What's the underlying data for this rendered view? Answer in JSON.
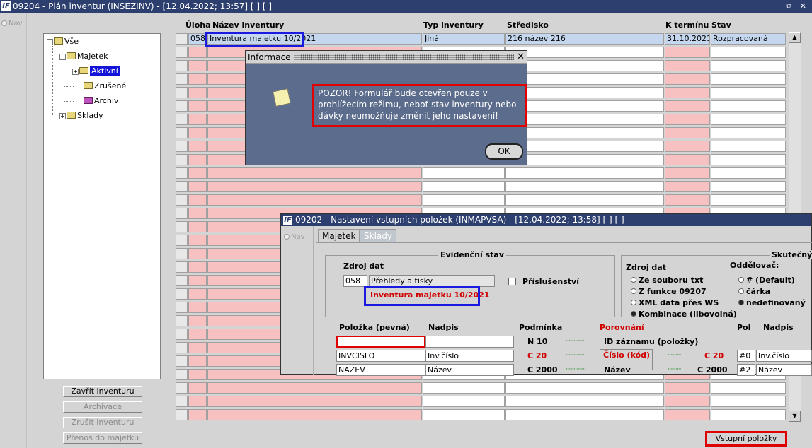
{
  "main_window": {
    "title": "09204 - Plán inventur (INSEZINV) - [12.04.2022; 13:57]  [ ]  [ ]",
    "controls": "⧉ ✕"
  },
  "nav_label": "Nav",
  "tree": {
    "root": "Vše",
    "majetek": "Majetek",
    "aktivni": "Aktivní",
    "zrusene": "Zrušené",
    "archiv": "Archiv",
    "sklady": "Sklady"
  },
  "side_buttons": {
    "zavrit": "Zavřít inventuru",
    "archivace": "Archivace",
    "zrusit": "Zrušit inventuru",
    "prenos": "Přenos do majetku"
  },
  "grid": {
    "headers": {
      "uloha": "Úloha",
      "nazev": "Název inventury",
      "typ": "Typ inventury",
      "stredisko": "Středisko",
      "termin": "K termínu",
      "stav": "Stav"
    },
    "first_row": {
      "uloha": "058",
      "nazev": "Inventura majetku 10/2021",
      "typ": "Jiná",
      "stredisko": "216 název 216",
      "termin": "31.10.2021",
      "stav": "Rozpracovaná"
    }
  },
  "vstup_button": "Vstupní položky",
  "info_dialog": {
    "title": "Informace",
    "message": "POZOR! Formulář bude otevřen pouze v prohlížecím režimu, neboť stav inventury nebo dávky neumožňuje změnit jeho nastavení!",
    "ok": "OK"
  },
  "win2": {
    "title": "09202 - Nastavení vstupních položek (INMAPVSA) - [12.04.2022; 13:58]  [ ]  [ ]",
    "nav": "Nav",
    "tabs": [
      "Majetek",
      "Sklady"
    ],
    "evidencni_stav": "Evidenční stav",
    "skutecny": "Skutečný",
    "zdroj_dat_left": "Zdroj dat",
    "zdroj_code": "058",
    "zdroj_name": "Přehledy a tisky",
    "inventura_name": "Inventura majetku 10/2021",
    "prislusenstvi": "Příslušenství",
    "zdroj_dat_right": "Zdroj dat",
    "oddelovac": "Oddělovač:",
    "radios_source": [
      "Ze souboru txt",
      "Z funkce 09207",
      "XML data přes WS",
      "Kombinace (libovolná)"
    ],
    "radios_sep": [
      "# (Default)",
      "čárka",
      "nedefinovaný"
    ],
    "cols": {
      "polozka": "Položka  (pevná)",
      "nadpis": "Nadpis",
      "podminka": "Podmínka",
      "porovnani": "Porovnání",
      "pol": "Pol",
      "nadpis2": "Nadpis"
    },
    "rows": [
      {
        "polozka": "",
        "nadpis": "",
        "podminka": "N 10",
        "mid": "ID záznamu (položky)",
        "c2": "",
        "pol": "",
        "nadpis2": ""
      },
      {
        "polozka": "INVCISLO",
        "nadpis": "Inv.číslo",
        "podminka": "C 20",
        "mid": "Číslo (kód)",
        "c2": "C 20",
        "pol": "#0",
        "nadpis2": "Inv.číslo"
      },
      {
        "polozka": "NAZEV",
        "nadpis": "Název",
        "podminka": "C 2000",
        "mid": "Název",
        "c2": "C 2000",
        "pol": "#2",
        "nadpis2": "Název"
      }
    ]
  }
}
